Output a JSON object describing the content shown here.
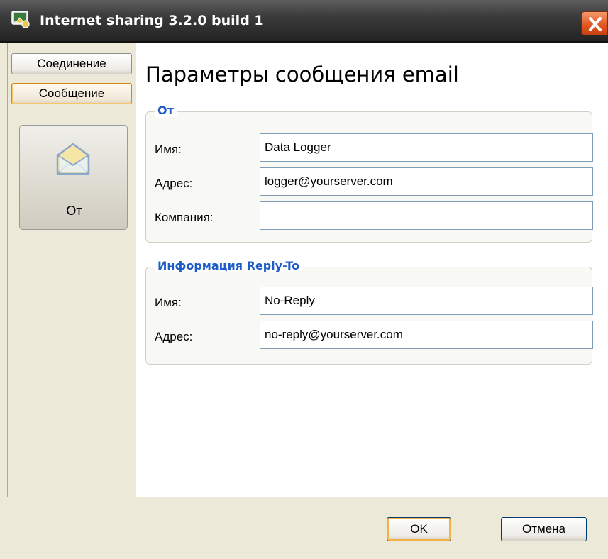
{
  "window": {
    "title": "Internet sharing 3.2.0 build 1"
  },
  "nav": {
    "connection_label": "Соединение",
    "message_label": "Сообщение"
  },
  "sidebar_item": {
    "label": "От",
    "icon": "envelope-icon"
  },
  "page": {
    "title": "Параметры сообщения email"
  },
  "from_group": {
    "label": "От",
    "name_label": "Имя:",
    "name_value": "Data Logger",
    "address_label": "Адрес:",
    "address_value": "logger@yourserver.com",
    "company_label": "Компания:",
    "company_value": ""
  },
  "reply_group": {
    "label": "Информация Reply-To",
    "name_label": "Имя:",
    "name_value": "No-Reply",
    "address_label": "Адрес:",
    "address_value": "no-reply@yourserver.com"
  },
  "buttons": {
    "ok_label": "OK",
    "cancel_label": "Отмена"
  },
  "colors": {
    "group_label": "#1f5cc8",
    "close_button": "#e1531e",
    "active_nav_border": "#d28a16"
  }
}
